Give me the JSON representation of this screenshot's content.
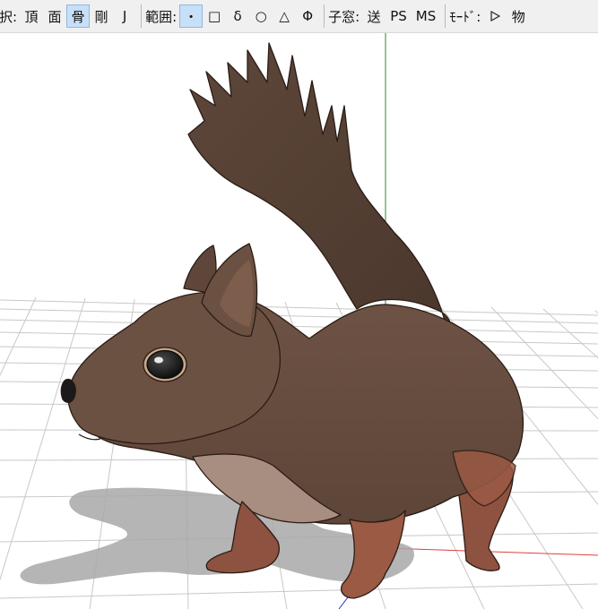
{
  "toolbar": {
    "select_label": "択:",
    "select_buttons": [
      {
        "label": "頂",
        "active": false
      },
      {
        "label": "面",
        "active": false
      },
      {
        "label": "骨",
        "active": true
      },
      {
        "label": "剛",
        "active": false
      },
      {
        "label": "J",
        "active": false
      }
    ],
    "range_label": "範囲:",
    "range_buttons": [
      {
        "label": "・",
        "active": true
      },
      {
        "label": "□",
        "active": false
      },
      {
        "label": "δ",
        "active": false
      },
      {
        "label": "○",
        "active": false
      },
      {
        "label": "△",
        "active": false
      },
      {
        "label": "Φ",
        "active": false
      }
    ],
    "child_window_label": "子窓:",
    "child_window_buttons": [
      {
        "label": "送"
      },
      {
        "label": "PS"
      },
      {
        "label": "MS"
      }
    ],
    "mode_label": "ﾓｰﾄﾞ:",
    "mode_play_icon": "play-triangle-icon",
    "mode_trailing": "物"
  },
  "viewport": {
    "grid_color": "#c8c8c8",
    "y_axis_color": "#2e8b2e",
    "x_axis_color": "#e04040",
    "z_axis_color": "#3030c0",
    "model": "squirrel",
    "fur_color": "#6b5142",
    "belly_color": "#a78e80",
    "paw_color": "#9a5a44"
  }
}
